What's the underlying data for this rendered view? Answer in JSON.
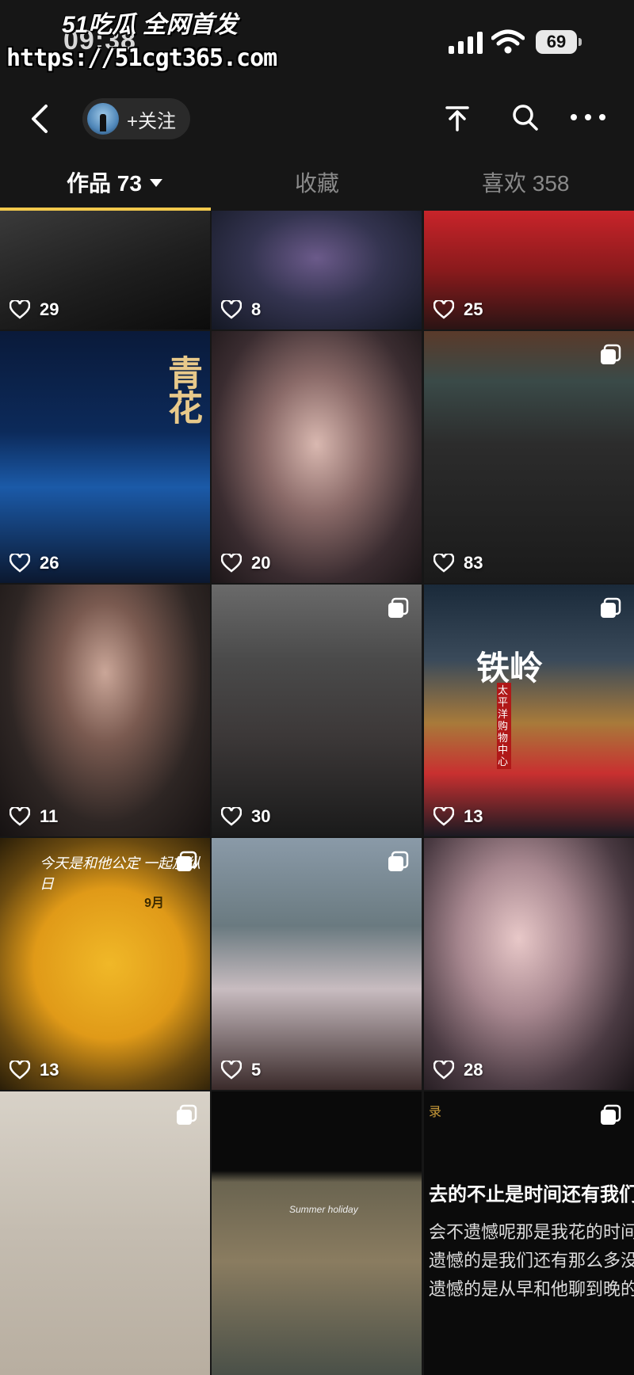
{
  "watermark": {
    "brand": "51吃瓜 全网首发",
    "url": "https://51cgt365.com"
  },
  "status_bar": {
    "time": "09:38",
    "battery": "69"
  },
  "nav": {
    "follow_label": "+关注"
  },
  "tabs": [
    {
      "label": "作品 73",
      "active": true
    },
    {
      "label": "收藏",
      "active": false
    },
    {
      "label": "喜欢 358",
      "active": false
    }
  ],
  "grid": [
    {
      "likes": "29",
      "multi": false
    },
    {
      "likes": "8",
      "multi": false
    },
    {
      "likes": "25",
      "multi": false
    },
    {
      "likes": "26",
      "multi": false,
      "overlay": "青花"
    },
    {
      "likes": "20",
      "multi": false
    },
    {
      "likes": "83",
      "multi": true
    },
    {
      "likes": "11",
      "multi": false
    },
    {
      "likes": "30",
      "multi": true
    },
    {
      "likes": "13",
      "multi": true,
      "overlay": "铁岭",
      "sign": "太平洋购物中心"
    },
    {
      "likes": "13",
      "multi": true,
      "calendar": {
        "script": "今天是和他公定 一起放纵日",
        "month": "9月"
      }
    },
    {
      "likes": "5",
      "multi": true
    },
    {
      "likes": "28",
      "multi": false
    },
    {
      "likes": "",
      "multi": true
    },
    {
      "likes": "",
      "multi": false,
      "overlay": "Summer holiday"
    },
    {
      "likes": "",
      "multi": true,
      "text_lines": [
        "录",
        "去的不止是时间还有我们",
        "会不遗憾呢那是我花的时间真心去",
        "遗憾的是我们还有那么多没有完成",
        "遗憾的是从早和他聊到晚的人不是"
      ]
    }
  ],
  "colors": {
    "accent": "#f2c94c",
    "background": "#161616"
  }
}
